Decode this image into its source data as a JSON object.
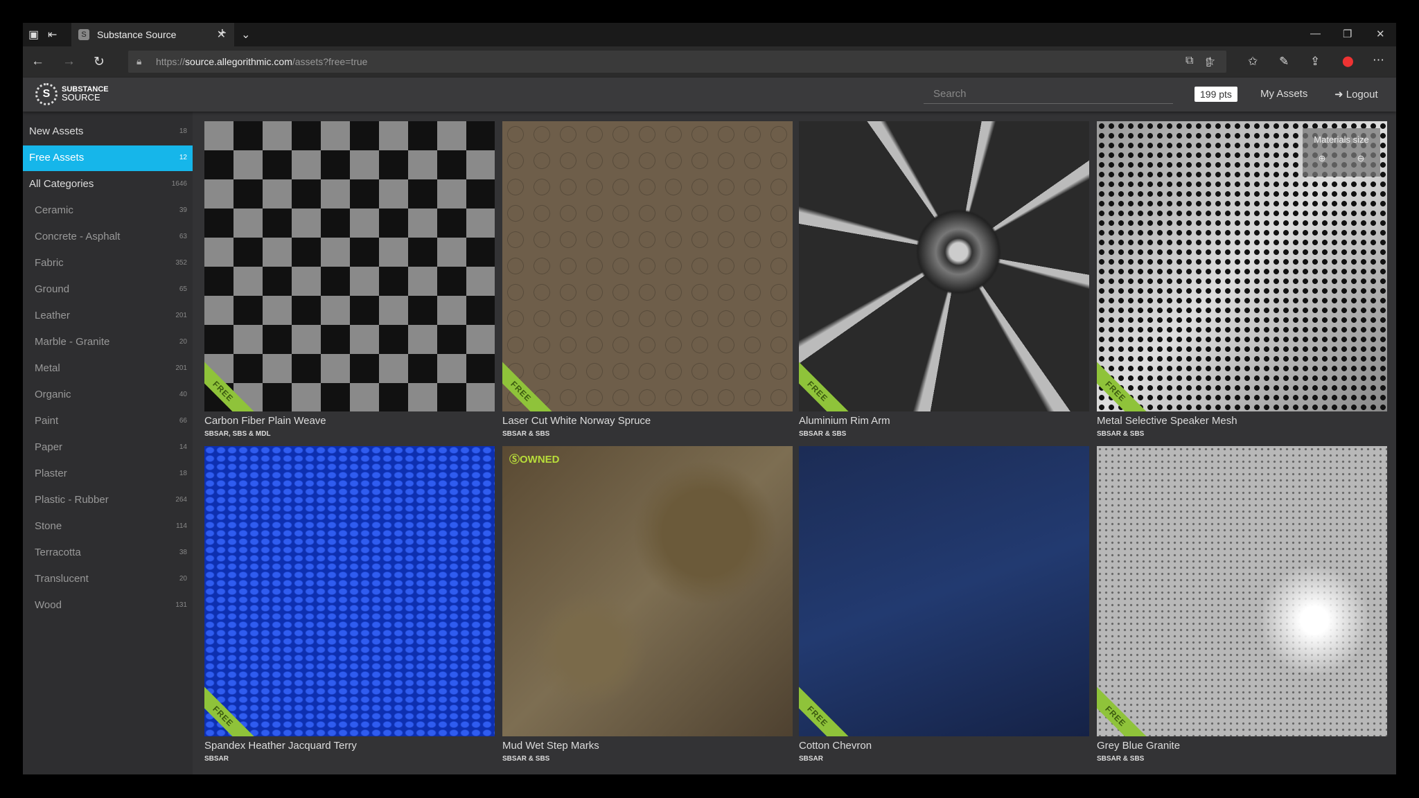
{
  "browser": {
    "tab_title": "Substance Source",
    "url_prefix": "https://",
    "url_domain": "source.allegorithmic.com",
    "url_path": "/assets?free=true"
  },
  "header": {
    "logo_line1": "SUBSTANCE",
    "logo_line2": "SOURCE",
    "search_placeholder": "Search",
    "points": "199 pts",
    "my_assets": "My Assets",
    "logout": "Logout"
  },
  "sidebar": {
    "items": [
      {
        "label": "New Assets",
        "count": "18"
      },
      {
        "label": "Free Assets",
        "count": "12",
        "selected": true
      },
      {
        "label": "All Categories",
        "count": "1646"
      },
      {
        "label": "Ceramic",
        "count": "39"
      },
      {
        "label": "Concrete - Asphalt",
        "count": "63"
      },
      {
        "label": "Fabric",
        "count": "352"
      },
      {
        "label": "Ground",
        "count": "65"
      },
      {
        "label": "Leather",
        "count": "201"
      },
      {
        "label": "Marble - Granite",
        "count": "20"
      },
      {
        "label": "Metal",
        "count": "201"
      },
      {
        "label": "Organic",
        "count": "40"
      },
      {
        "label": "Paint",
        "count": "66"
      },
      {
        "label": "Paper",
        "count": "14"
      },
      {
        "label": "Plaster",
        "count": "18"
      },
      {
        "label": "Plastic - Rubber",
        "count": "264"
      },
      {
        "label": "Stone",
        "count": "114"
      },
      {
        "label": "Terracotta",
        "count": "38"
      },
      {
        "label": "Translucent",
        "count": "20"
      },
      {
        "label": "Wood",
        "count": "131"
      }
    ]
  },
  "overlay": {
    "materials_size": "Materials size"
  },
  "badges": {
    "free": "FREE",
    "owned": "OWNED"
  },
  "assets": [
    {
      "title": "Carbon Fiber Plain Weave",
      "formats": "SBSAR, SBS & MDL"
    },
    {
      "title": "Laser Cut White Norway Spruce",
      "formats": "SBSAR & SBS"
    },
    {
      "title": "Aluminium Rim Arm",
      "formats": "SBSAR & SBS"
    },
    {
      "title": "Metal Selective Speaker Mesh",
      "formats": "SBSAR & SBS"
    },
    {
      "title": "Spandex Heather Jacquard Terry",
      "formats": "SBSAR"
    },
    {
      "title": "Mud Wet Step Marks",
      "formats": "SBSAR & SBS"
    },
    {
      "title": "Cotton Chevron",
      "formats": "SBSAR"
    },
    {
      "title": "Grey Blue Granite",
      "formats": "SBSAR & SBS"
    }
  ]
}
